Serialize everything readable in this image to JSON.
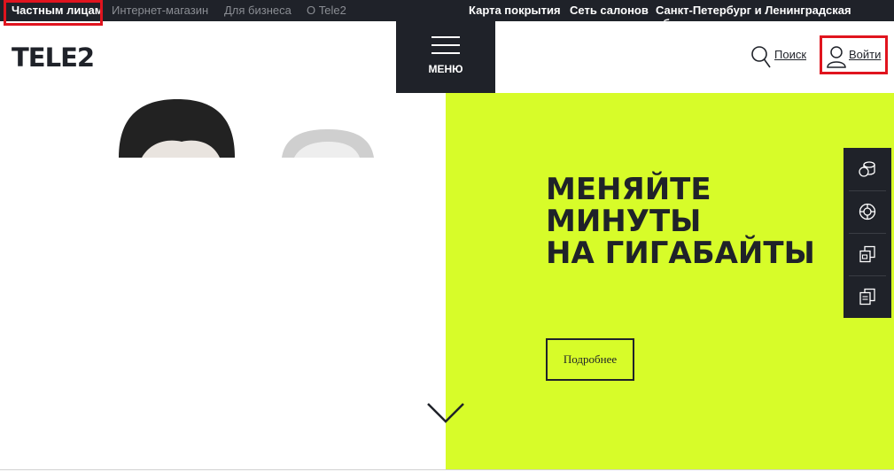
{
  "topbar": {
    "left_links": [
      "Частным лицам",
      "Интернет-магазин",
      "Для бизнеса",
      "О Tele2"
    ],
    "right_links": [
      "Карта покрытия",
      "Сеть салонов",
      "Санкт-Петербург и Ленинградская область ⌄"
    ]
  },
  "header": {
    "logo": "TELE2",
    "menu_label": "МЕНЮ",
    "search_label": "Поиск",
    "login_label": "Войти"
  },
  "hero": {
    "headline": [
      "МЕНЯЙТЕ",
      "МИНУТЫ",
      "НА ГИГАБАЙТЫ"
    ],
    "button_label": "Подробнее"
  },
  "side_panel": {
    "icons": [
      "coins-icon",
      "lifebuoy-icon",
      "sim-cards-icon",
      "documents-icon"
    ]
  },
  "colors": {
    "dark": "#1f2229",
    "accent_green": "#d7fc29",
    "highlight_red": "#e0141e"
  }
}
